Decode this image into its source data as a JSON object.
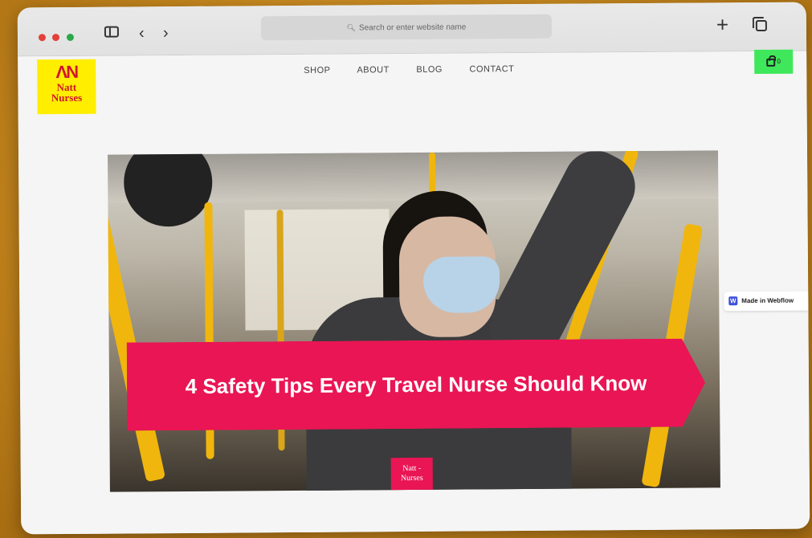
{
  "browser": {
    "url_placeholder": "Search or enter website name"
  },
  "site": {
    "logo": {
      "line1": "Natt",
      "line2": "Nurses"
    },
    "nav": [
      "SHOP",
      "ABOUT",
      "BLOG",
      "CONTACT"
    ],
    "cart_count": "0"
  },
  "hero": {
    "title": "4 Safety Tips Every Travel Nurse Should Know",
    "badge": {
      "line1": "Natt -",
      "line2": "Nurses"
    }
  },
  "webflow_badge": {
    "icon": "W",
    "label": "Made in Webflow"
  },
  "colors": {
    "accent_pink": "#ea1554",
    "cart_green": "#3ee85a",
    "logo_yellow": "#ffee00",
    "logo_red": "#d2162c"
  }
}
